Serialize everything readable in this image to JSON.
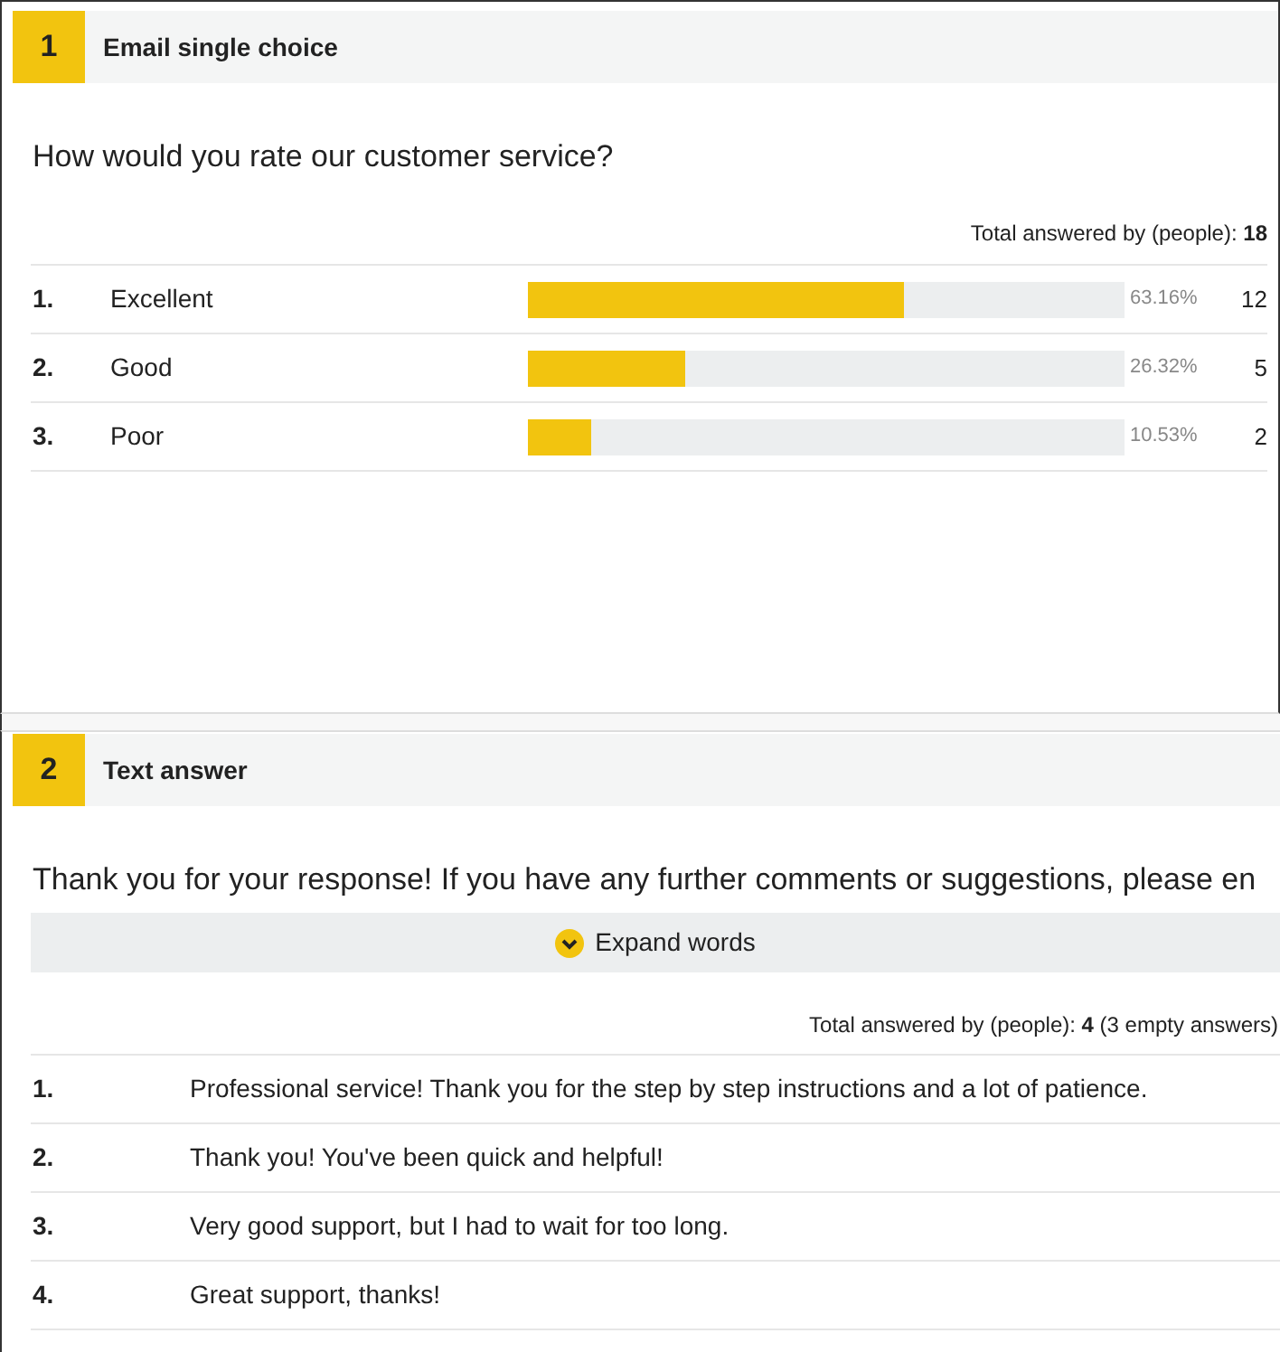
{
  "sections": [
    {
      "kind": "choice",
      "number": "1",
      "title": "Email single choice",
      "question": "How would you rate our customer service?",
      "total": "Total answered by (people): **18**",
      "options": [
        {
          "index": "1.",
          "label": "Excellent",
          "level": 0.6316,
          "percent": "63.16%",
          "count": "12"
        },
        {
          "index": "2.",
          "label": "Good",
          "level": 0.2632,
          "percent": "26.32%",
          "count": "5"
        },
        {
          "index": "3.",
          "label": "Poor",
          "level": 0.1053,
          "percent": "10.53%",
          "count": "2"
        }
      ]
    },
    {
      "kind": "text",
      "number": "2",
      "title": "Text answer",
      "question": "Thank you for your response! If you have any further comments or suggestions, please en",
      "expand_button": "Expand words",
      "total": "Total answered by (people): **4** (3 empty answers)",
      "answers": [
        {
          "index": "1.",
          "text": "Professional service! Thank you for the step by step instructions and a lot of patience."
        },
        {
          "index": "2.",
          "text": "Thank you! You've been quick and helpful!"
        },
        {
          "index": "3.",
          "text": "Very good support, but I had to wait for too long."
        },
        {
          "index": "4.",
          "text": "Great support, thanks!"
        }
      ]
    }
  ]
}
